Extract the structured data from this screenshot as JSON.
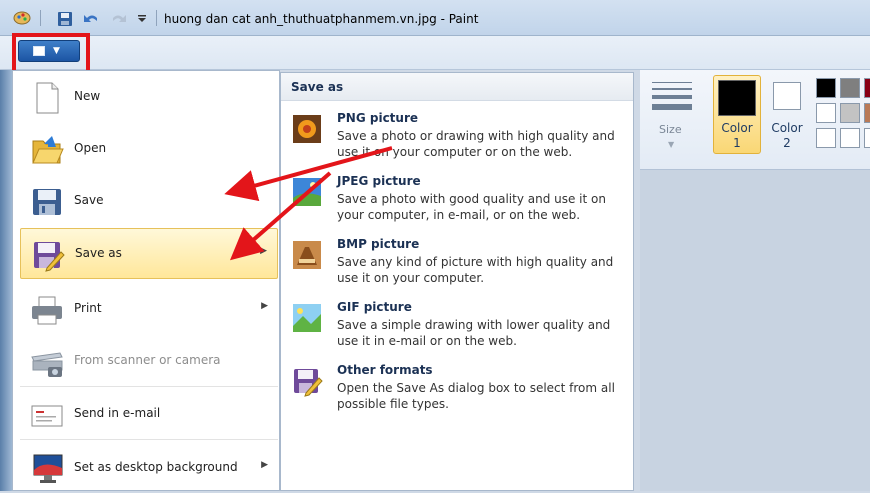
{
  "window": {
    "title": "huong dan cat anh_thuthuatphanmem.vn.jpg - Paint"
  },
  "app_menu": {
    "button_icon": "paint-menu-icon",
    "items": [
      {
        "label": "New",
        "icon": "new-document-icon",
        "submenu": false,
        "enabled": true
      },
      {
        "label": "Open",
        "icon": "open-folder-icon",
        "submenu": false,
        "enabled": true
      },
      {
        "label": "Save",
        "icon": "floppy-disk-icon",
        "submenu": false,
        "enabled": true
      },
      {
        "label": "Save as",
        "icon": "save-as-icon",
        "submenu": true,
        "enabled": true,
        "active": true
      },
      {
        "label": "Print",
        "icon": "printer-icon",
        "submenu": true,
        "enabled": true
      },
      {
        "label": "From scanner or camera",
        "icon": "scanner-icon",
        "submenu": false,
        "enabled": false
      },
      {
        "label": "Send in e-mail",
        "icon": "email-icon",
        "submenu": false,
        "enabled": true
      },
      {
        "label": "Set as desktop background",
        "icon": "desktop-icon",
        "submenu": true,
        "enabled": true
      }
    ]
  },
  "save_as_menu": {
    "header": "Save as",
    "items": [
      {
        "title": "PNG picture",
        "description": "Save a photo or drawing with high quality and use it on your computer or on the web.",
        "icon": "png-picture-icon"
      },
      {
        "title": "JPEG picture",
        "description": "Save a photo with good quality and use it on your computer, in e-mail, or on the web.",
        "icon": "jpeg-picture-icon"
      },
      {
        "title": "BMP picture",
        "description": "Save any kind of picture with high quality and use it on your computer.",
        "icon": "bmp-picture-icon"
      },
      {
        "title": "GIF picture",
        "description": "Save a simple drawing with lower quality and use it in e-mail or on the web.",
        "icon": "gif-picture-icon"
      },
      {
        "title": "Other formats",
        "description": "Open the Save As dialog box to select from all possible file types.",
        "icon": "other-formats-icon"
      }
    ]
  },
  "ribbon": {
    "size_label": "Size",
    "color1_label": "Color",
    "color1_num": "1",
    "color2_label": "Color",
    "color2_num": "2",
    "color1_value": "#000000",
    "color2_value": "#ffffff",
    "palette": [
      "#000000",
      "#7f7f7f",
      "#880015",
      "#ffffff",
      "#c3c3c3",
      "#b97a57",
      "#ffffff",
      "#ffffff",
      "#ffffff"
    ]
  },
  "annotations": {
    "highlight_color": "#e3151a",
    "arrow_color": "#e3151a"
  }
}
